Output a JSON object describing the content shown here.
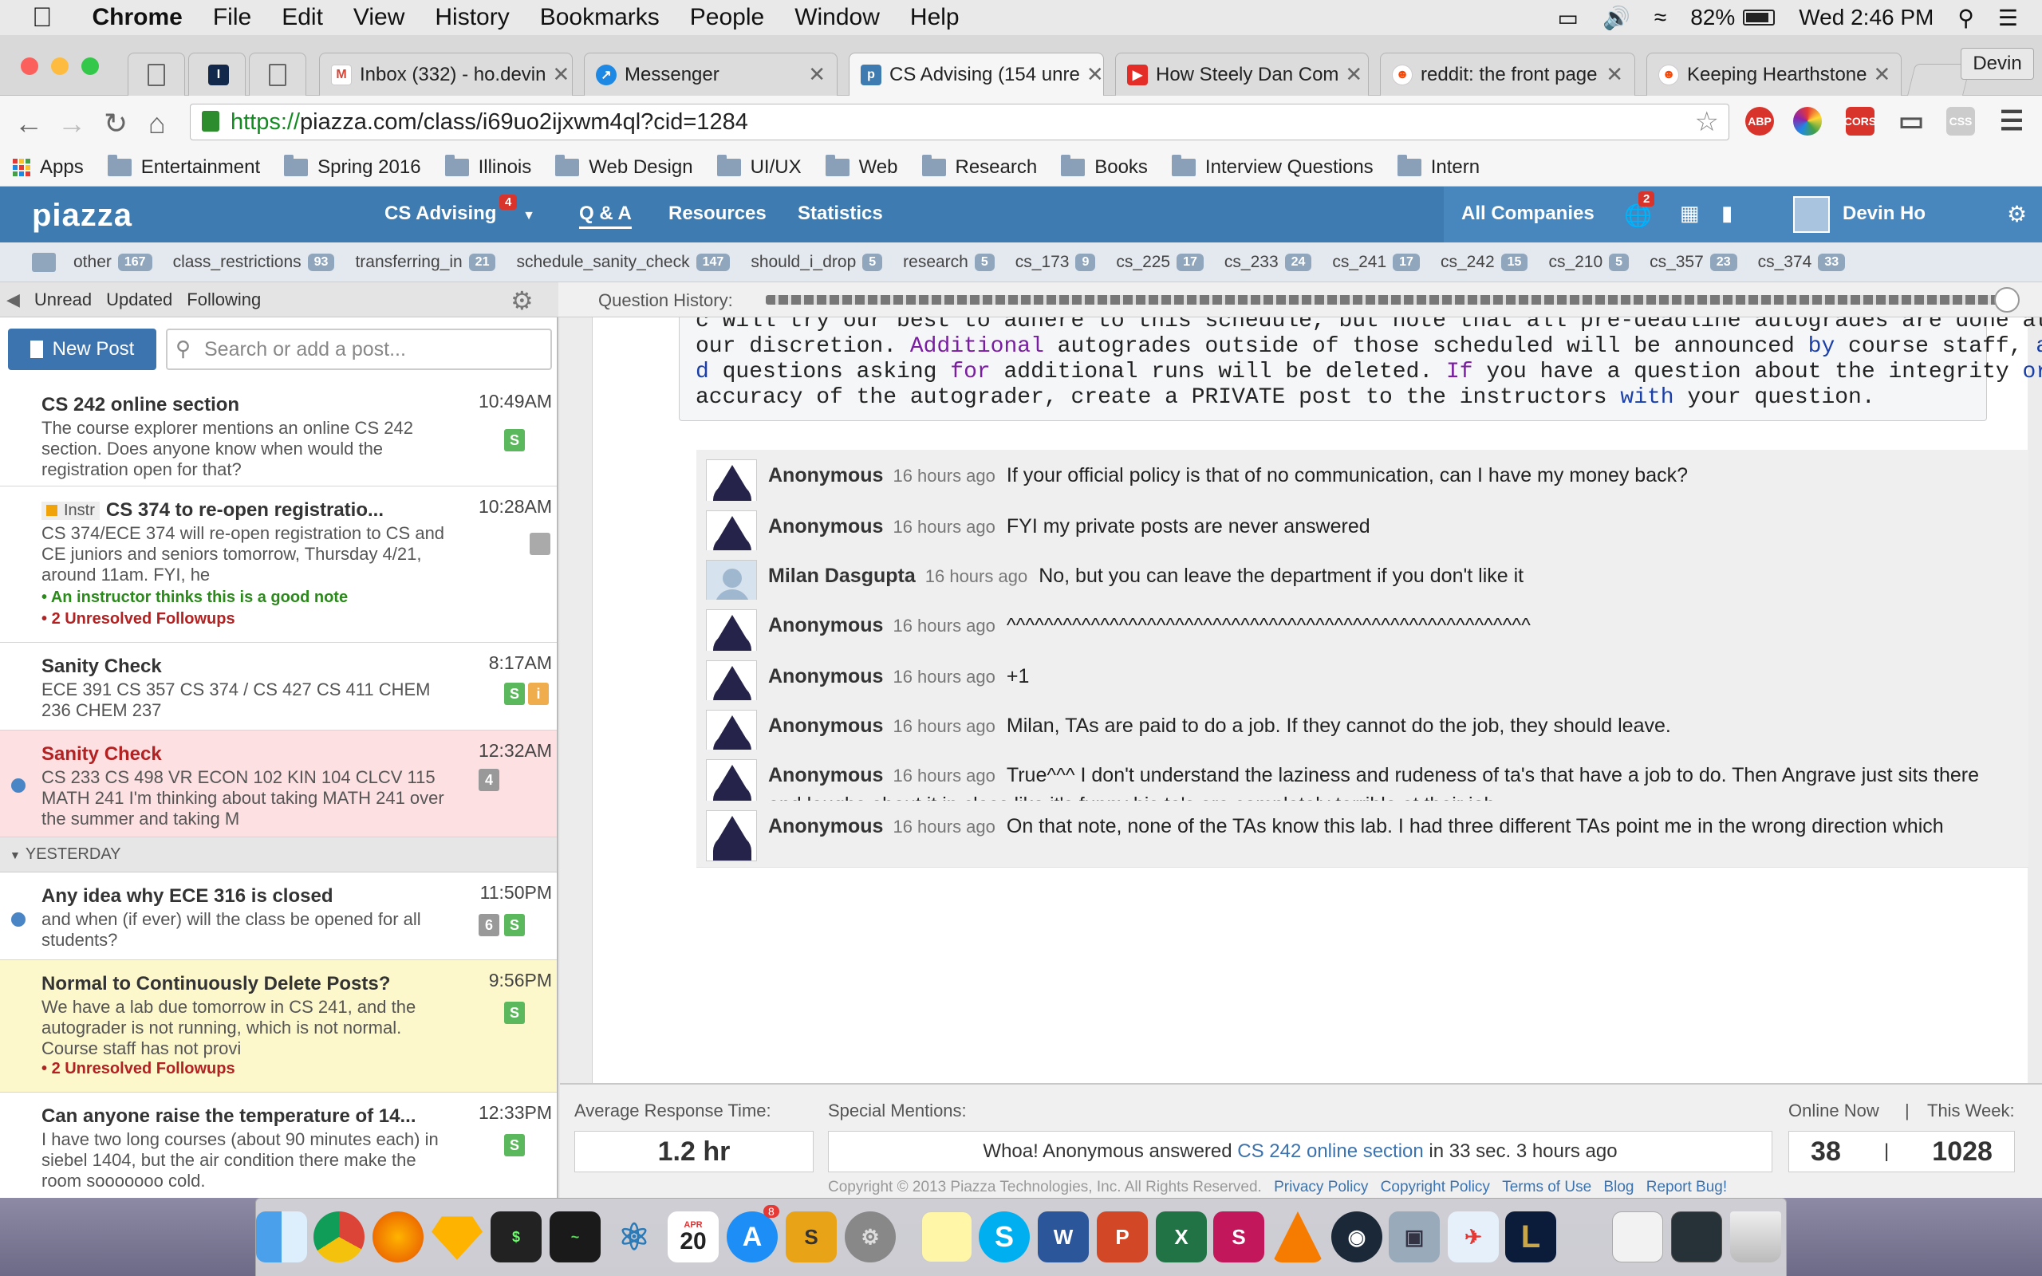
{
  "menubar": {
    "apple": "",
    "app": "Chrome",
    "items": [
      "File",
      "Edit",
      "View",
      "History",
      "Bookmarks",
      "People",
      "Window",
      "Help"
    ],
    "battery": "82%",
    "clock": "Wed 2:46 PM"
  },
  "tabs": [
    {
      "label": "Inbox (332) - ho.devin",
      "type": "gmail"
    },
    {
      "label": "Messenger",
      "type": "messenger"
    },
    {
      "label": "CS Advising (154 unre",
      "type": "piazza",
      "active": true
    },
    {
      "label": "How Steely Dan Com",
      "type": "youtube"
    },
    {
      "label": "reddit: the front page",
      "type": "reddit"
    },
    {
      "label": "Keeping Hearthstone",
      "type": "reddit"
    }
  ],
  "profile": "Devin",
  "address": {
    "scheme": "https://",
    "rest": "piazza.com/class/i69uo2ijxwm4ql?cid=1284"
  },
  "extensions": {
    "abp": "ABP",
    "cors": "CORS",
    "css": "CSS"
  },
  "bookmarks": [
    "Apps",
    "Entertainment",
    "Spring 2016",
    "Illinois",
    "Web Design",
    "UI/UX",
    "Web",
    "Research",
    "Books",
    "Interview Questions",
    "Intern"
  ],
  "piazza": {
    "logo": "piazza",
    "course": "CS Advising",
    "course_badge": "4",
    "nav": [
      "Q & A",
      "Resources",
      "Statistics"
    ],
    "all_companies": "All Companies",
    "globe_badge": "2",
    "user": "Devin Ho"
  },
  "folders": [
    {
      "name": "other",
      "count": "167"
    },
    {
      "name": "class_restrictions",
      "count": "93"
    },
    {
      "name": "transferring_in",
      "count": "21"
    },
    {
      "name": "schedule_sanity_check",
      "count": "147"
    },
    {
      "name": "should_i_drop",
      "count": "5"
    },
    {
      "name": "research",
      "count": "5"
    },
    {
      "name": "cs_173",
      "count": "9"
    },
    {
      "name": "cs_225",
      "count": "17"
    },
    {
      "name": "cs_233",
      "count": "24"
    },
    {
      "name": "cs_241",
      "count": "17"
    },
    {
      "name": "cs_242",
      "count": "15"
    },
    {
      "name": "cs_210",
      "count": "5"
    },
    {
      "name": "cs_357",
      "count": "23"
    },
    {
      "name": "cs_374",
      "count": "33"
    }
  ],
  "filters": [
    "Unread",
    "Updated",
    "Following"
  ],
  "question_history": "Question History:",
  "new_post": "New Post",
  "search_placeholder": "Search or add a post...",
  "yesterday": "YESTERDAY",
  "posts": [
    {
      "title": "CS 242 online section",
      "snip": "The course explorer mentions an online CS 242 section. Does anyone know when would the registration open for that?",
      "time": "10:49AM"
    },
    {
      "instr": "Instr",
      "title": "CS 374 to re-open registratio...",
      "snip": "CS 374/ECE 374 will re-open registration to CS and CE juniors and seniors tomorrow, Thursday 4/21, around 11am. FYI, he",
      "time": "10:28AM",
      "note1": "An instructor thinks this is a good note",
      "note2": "2 Unresolved Followups"
    },
    {
      "title": "Sanity Check",
      "snip": "ECE 391 CS 357 CS 374 / CS 427 CS 411 CHEM 236 CHEM 237",
      "time": "8:17AM"
    },
    {
      "title": "Sanity Check",
      "snip": "CS 233 CS 498 VR ECON 102 KIN 104 CLCV 115 MATH 241 I'm thinking about taking MATH 241 over the summer and taking M",
      "time": "12:32AM",
      "badge": "4"
    },
    {
      "title": "Any idea why ECE 316 is closed",
      "snip": "and when (if ever) will the class be opened for all students?",
      "time": "11:50PM",
      "badge": "6"
    },
    {
      "title": "Normal to Continuously Delete Posts?",
      "snip": "We have a lab due tomorrow in CS 241, and the autograder is not running, which is not normal. Course staff has not provi",
      "time": "9:56PM",
      "note2": "2 Unresolved Followups"
    },
    {
      "title": "Can anyone raise the temperature of 14...",
      "snip": "I have two long courses (about 90 minutes each) in siebel 1404, but the air condition there make the room sooooooo cold.",
      "time": "12:33PM"
    }
  ],
  "badge_s": "S",
  "badge_i": "i",
  "code_lines": [
    [
      "c will try our best to adhere to this schedule, but note that all pre-deadline autogrades are done at"
    ],
    [
      "our discretion. ",
      {
        "k": "Additional"
      },
      " autogrades outside of those scheduled will be announced ",
      {
        "f": "by"
      },
      " course staff, ",
      {
        "f": "an"
      }
    ],
    [
      {
        "f": "d"
      },
      " questions asking ",
      {
        "k": "for"
      },
      " additional runs will be deleted. ",
      {
        "k": "If"
      },
      " you have a question about the integrity ",
      {
        "f": "or"
      }
    ],
    [
      "accuracy of the autograder, create a PRIVATE post to the instructors ",
      {
        "f": "with"
      },
      " your question."
    ]
  ],
  "followups": [
    {
      "name": "Anonymous",
      "ago": "16 hours ago",
      "text": "If your official policy is that of no communication, can I have my money back?"
    },
    {
      "name": "Anonymous",
      "ago": "16 hours ago",
      "text": "FYI my private posts are never answered"
    },
    {
      "name": "Milan Dasgupta",
      "ago": "16 hours ago",
      "text": "No, but you can leave the department if you don't like it",
      "user": true
    },
    {
      "name": "Anonymous",
      "ago": "16 hours ago",
      "text": "^^^^^^^^^^^^^^^^^^^^^^^^^^^^^^^^^^^^^^^^^^^^^^^^^^^^^^^^"
    },
    {
      "name": "Anonymous",
      "ago": "16 hours ago",
      "text": "+1"
    },
    {
      "name": "Anonymous",
      "ago": "16 hours ago",
      "text": "Milan, TAs are paid to do a job. If they cannot do the job, they should leave."
    },
    {
      "name": "Anonymous",
      "ago": "16 hours ago",
      "text": "True^^^  I don't understand the laziness and rudeness of ta's that have a job to do.  Then Angrave just sits there and laughs about it in class like it's funny his ta's are completely terrible at their job."
    },
    {
      "name": "Anonymous",
      "ago": "16 hours ago",
      "text": "On that note, none of the TAs know this lab. I had three different TAs point me in the wrong direction which"
    }
  ],
  "stats": {
    "avg_label": "Average Response Time:",
    "avg_value": "1.2 hr",
    "special_label": "Special Mentions:",
    "special_pre": "Whoa! Anonymous answered ",
    "special_link": "CS 242 online section",
    "special_post": " in 33 sec. 3 hours ago",
    "online_label": "Online Now",
    "sep": "|",
    "week_label": "This Week:",
    "online_value": "38",
    "week_value": "1028",
    "copyright": "Copyright © 2013 Piazza Technologies, Inc. All Rights Reserved.",
    "footer_links": [
      "Privacy Policy",
      "Copyright Policy",
      "Terms of Use",
      "Blog",
      "Report Bug!"
    ]
  },
  "dock": {
    "calendar_month": "APR",
    "calendar_day": "20",
    "appstore_badge": "8"
  },
  "colors": {
    "piazza_blue": "#3e7bb0",
    "highlight_pink": "#fde0e2",
    "highlight_yellow": "#fdf7cc",
    "note_green": "#2a8a1a",
    "note_red": "#b22222",
    "badge_green": "#5cb85c",
    "badge_orange": "#f0ad4e"
  }
}
